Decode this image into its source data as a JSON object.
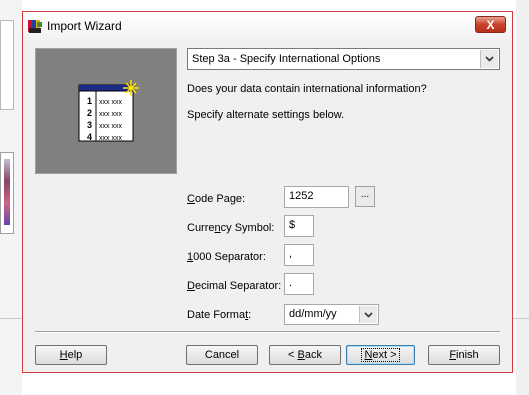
{
  "window": {
    "title": "Import Wizard",
    "close_glyph": "X"
  },
  "wizard": {
    "step_selected": "Step 3a - Specify International Options",
    "question": "Does your data contain international information?",
    "instruction": "Specify alternate settings below.",
    "illustration_rows": [
      {
        "num": "1",
        "cells": "xxx xxx"
      },
      {
        "num": "2",
        "cells": "xxx xxx"
      },
      {
        "num": "3",
        "cells": "xxx xxx"
      },
      {
        "num": "4",
        "cells": "xxx xxx"
      }
    ]
  },
  "fields": {
    "code_page": {
      "label_u": "C",
      "label_rest": "ode Page:",
      "value": "1252",
      "browse_label": "..."
    },
    "currency_symbol": {
      "label_pre": "Curre",
      "label_u": "n",
      "label_rest": "cy Symbol:",
      "value": "$"
    },
    "thousand_separator": {
      "label_u": "1",
      "label_rest": "000 Separator:",
      "value": ","
    },
    "decimal_separator": {
      "label_u": "D",
      "label_rest": "ecimal Separator:",
      "value": "."
    },
    "date_format": {
      "label_pre": "Date Forma",
      "label_u": "t",
      "label_rest": ":",
      "value": "dd/mm/yy"
    }
  },
  "buttons": {
    "help": {
      "u": "H",
      "rest": "elp"
    },
    "cancel": {
      "label": "Cancel"
    },
    "back": {
      "pre": "< ",
      "u": "B",
      "rest": "ack"
    },
    "next": {
      "u": "N",
      "rest": "ext >"
    },
    "finish": {
      "u": "F",
      "rest": "inish"
    }
  },
  "colors": {
    "dialog_border": "#d23c3c",
    "close_button": "#c7432a",
    "illustration_bg": "#808080",
    "illustration_header": "#1c2a8a"
  }
}
